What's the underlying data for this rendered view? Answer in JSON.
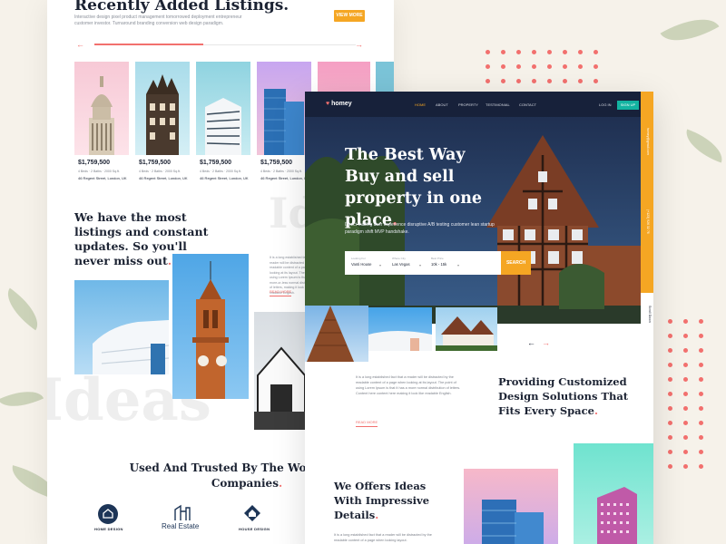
{
  "back_page": {
    "title": "Recently Added Listings.",
    "subtitle": "Interactive design pixel product management tomorrowed deployment entrepreneur customer investor. Turnaround branding conversion web design paradigm.",
    "view_more_label": "VIEW MORE",
    "prev_arrow": "←",
    "next_arrow": "→",
    "listings": [
      {
        "price": "$1,759,500",
        "beds": "4 Beds",
        "baths": "2 Baths",
        "area": "2000 Sq.ft.",
        "address": "46 Regent Street, London, UK"
      },
      {
        "price": "$1,759,500",
        "beds": "4 Beds",
        "baths": "2 Baths",
        "area": "2000 Sq.ft.",
        "address": "46 Regent Street, London, UK"
      },
      {
        "price": "$1,759,500",
        "beds": "4 Beds",
        "baths": "2 Baths",
        "area": "2000 Sq.ft.",
        "address": "46 Regent Street, London, UK"
      },
      {
        "price": "$1,759,500",
        "beds": "4 Beds",
        "baths": "2 Baths",
        "area": "2000 Sq.ft.",
        "address": "46 Regent Street, London, UK"
      }
    ],
    "section_heading": "We have the most listings and constant updates. So you'll never miss out",
    "section_heading_dot": ".",
    "section_paragraph": "It is a long established fact that a reader will be distracted by the readable content of a page when looking at its layout. The point of using Lorem Ipsum is that it has a more-or-less normal distribution of letters, making it look like readable English.",
    "read_more_label": "READ MORE",
    "ghost_word_a": "Id",
    "ghost_word_b": "Ideas",
    "trusted_heading": "Used And Trusted By The World's Best Companies",
    "trusted_heading_dot": ".",
    "partner_logos": [
      {
        "name": "HOME DESIGN",
        "icon": "house-badge-icon"
      },
      {
        "name": "Real Estate",
        "icon": "buildings-icon"
      },
      {
        "name": "HOUSE DESIGN",
        "icon": "diamond-house-icon"
      }
    ]
  },
  "front_page": {
    "nav": {
      "brand": "homey",
      "brand_icon": "heart-icon",
      "items": [
        "HOME",
        "ABOUT",
        "PROPERTY",
        "TESTIMONIAL",
        "CONTACT"
      ],
      "active_index": 0,
      "login_label": "LOG IN",
      "signup_label": "SIGN UP"
    },
    "hero": {
      "title": "The Best Way Buy and sell property in one place",
      "title_dot": ".",
      "subtitle": "Direct mailing user experience disruptive A/B testing customer lean startup paradigm shift MVP handshake."
    },
    "search": {
      "fields": [
        {
          "label": "Looking For",
          "value": "Vanti House"
        },
        {
          "label": "Where City",
          "value": "Las Vegas"
        },
        {
          "label": "Best Price",
          "value": "10k - 15k"
        }
      ],
      "button_label": "SEARCH"
    },
    "side_contact": {
      "email": "homey@gmail.com",
      "phone": "(+123) 926 32 76"
    },
    "scroll_down_label": "Scroll Down",
    "slider_prev": "←",
    "slider_next": "→",
    "intro_paragraph": "It is a long established fact that a reader will be distracted by the readable content of a page when looking at its layout. The point of using Lorem Ipsum is that it has a more normal distribution of letters. Content here content here making it look like readable English.",
    "read_more_label": "READ MORE",
    "design_heading": "Providing Customized Design Solutions That Fits Every Space",
    "design_heading_dot": ".",
    "ideas_heading": "We Offers Ideas With Impressive Details",
    "ideas_heading_dot": ".",
    "ideas_paragraph": "It is a long established fact that a reader will be distracted by the readable content of a page when looking layout."
  },
  "colors": {
    "accent_orange": "#f5a623",
    "accent_coral": "#f2706e",
    "navy": "#1c2333",
    "teal": "#13b3a1"
  }
}
